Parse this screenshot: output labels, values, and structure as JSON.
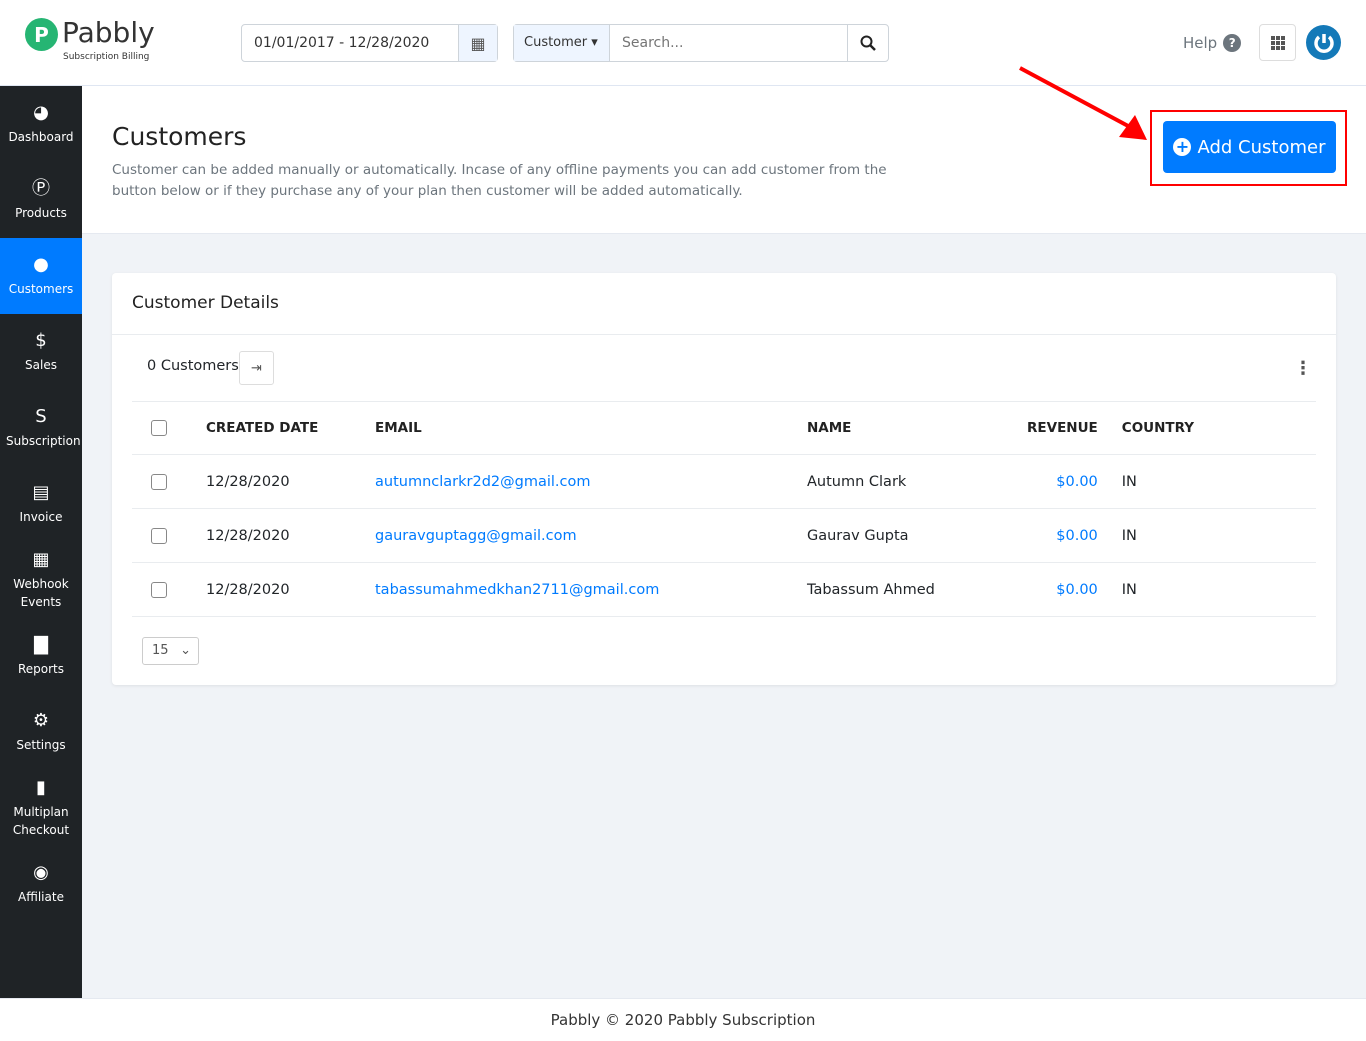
{
  "brand": {
    "name": "Pabbly",
    "tagline": "Subscription Billing",
    "logo_letter": "P"
  },
  "header": {
    "date_range": "01/01/2017 - 12/28/2020",
    "search_type": "Customer",
    "search_placeholder": "Search...",
    "help": "Help"
  },
  "sidebar": {
    "items": [
      {
        "label": "Dashboard",
        "icon": "◕"
      },
      {
        "label": "Products",
        "icon": "Ⓟ"
      },
      {
        "label": "Customers",
        "icon": "●",
        "active": true
      },
      {
        "label": "Sales",
        "icon": "$"
      },
      {
        "label": "Subscription",
        "icon": "S"
      },
      {
        "label": "Invoice",
        "icon": "▤"
      },
      {
        "label": "Webhook Events",
        "icon": "▦"
      },
      {
        "label": "Reports",
        "icon": "▇"
      },
      {
        "label": "Settings",
        "icon": "⚙"
      },
      {
        "label": "Multiplan Checkout",
        "icon": "▮"
      },
      {
        "label": "Affiliate",
        "icon": "◉"
      }
    ]
  },
  "page": {
    "title": "Customers",
    "description": "Customer can be added manually or automatically. Incase of any offline payments you can add customer from the button below or if they purchase any of your plan then customer will be added automatically.",
    "add_button": "Add Customer"
  },
  "card": {
    "title": "Customer Details",
    "count": "0 Customers",
    "per_page": "15",
    "columns": [
      "CREATED DATE",
      "EMAIL",
      "NAME",
      "REVENUE",
      "COUNTRY"
    ],
    "rows": [
      {
        "date": "12/28/2020",
        "email": "autumnclarkr2d2@gmail.com",
        "name": "Autumn Clark",
        "revenue": "$0.00",
        "country": "IN"
      },
      {
        "date": "12/28/2020",
        "email": "gauravguptagg@gmail.com",
        "name": "Gaurav Gupta",
        "revenue": "$0.00",
        "country": "IN"
      },
      {
        "date": "12/28/2020",
        "email": "tabassumahmedkhan2711@gmail.com",
        "name": "Tabassum Ahmed",
        "revenue": "$0.00",
        "country": "IN"
      }
    ]
  },
  "footer": "Pabbly © 2020 Pabbly Subscription",
  "colors": {
    "primary": "#007bff",
    "sidebar": "#1f2326",
    "brand_green": "#26b573",
    "annotation": "#ff0000"
  }
}
